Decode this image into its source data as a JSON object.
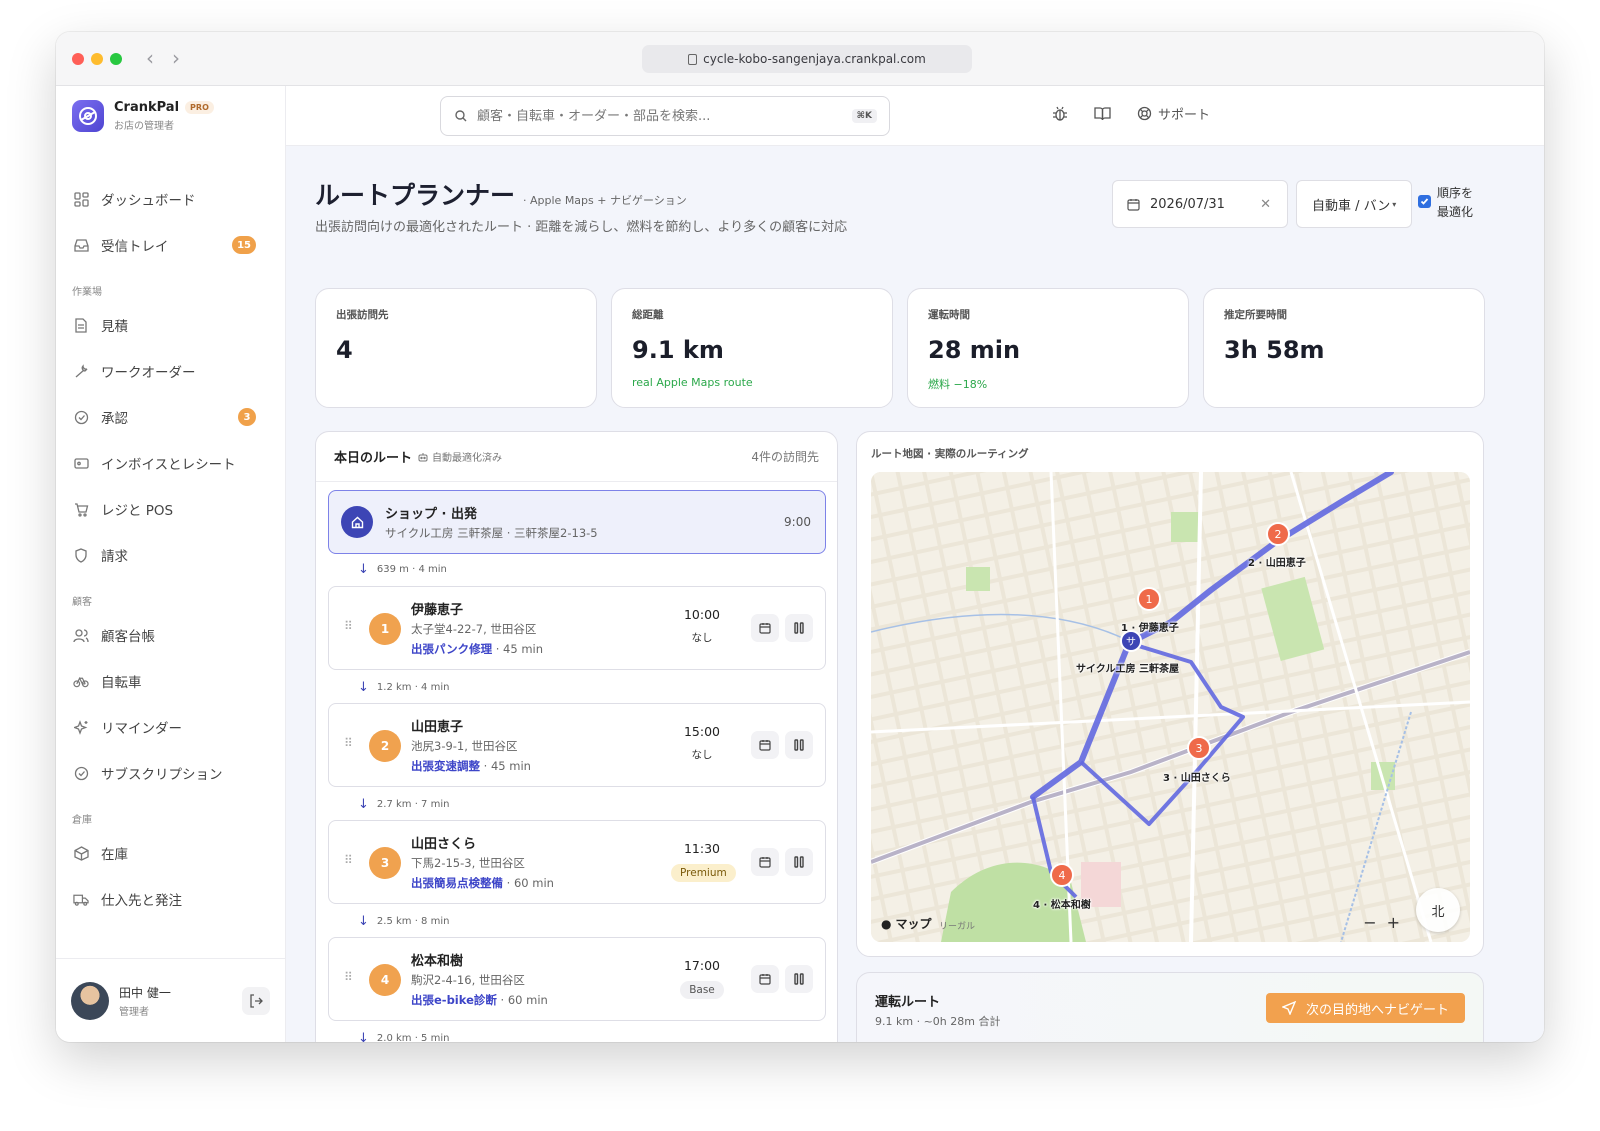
{
  "browser": {
    "url": "cycle-kobo-sangenjaya.crankpal.com"
  },
  "brand": {
    "name": "CrankPal",
    "tier": "PRO",
    "subtitle": "お店の管理者"
  },
  "nav": {
    "dashboard": "ダッシュボード",
    "inbox": "受信トレイ",
    "inbox_badge": "15",
    "section_workshop": "作業場",
    "estimates": "見積",
    "work_orders": "ワークオーダー",
    "approvals": "承認",
    "approvals_badge": "3",
    "invoices": "インボイスとレシート",
    "pos": "レジと POS",
    "billing": "請求",
    "section_customers": "顧客",
    "customer_ledger": "顧客台帳",
    "bikes": "自転車",
    "reminders": "リマインダー",
    "subscriptions": "サブスクリプション",
    "section_warehouse": "倉庫",
    "inventory": "在庫",
    "suppliers": "仕入先と発注"
  },
  "user": {
    "name": "田中 健一",
    "role": "管理者"
  },
  "topbar": {
    "search_placeholder": "顧客・自転車・オーダー・部品を検索...",
    "shortcut": "⌘K",
    "support": "サポート"
  },
  "page": {
    "title": "ルートプランナー",
    "subtitle": "· Apple Maps + ナビゲーション",
    "description": "出張訪問向けの最適化されたルート · 距離を減らし、燃料を節約し、より多くの顧客に対応",
    "date": "2026/07/31",
    "vehicle": "自動車 / バン",
    "optimize_line1": "順序を",
    "optimize_line2": "最適化"
  },
  "stats": [
    {
      "label": "出張訪問先",
      "value": "4",
      "note": ""
    },
    {
      "label": "総距離",
      "value": "9.1 km",
      "note": "real Apple Maps route"
    },
    {
      "label": "運転時間",
      "value": "28 min",
      "note": "燃料 −18%"
    },
    {
      "label": "推定所要時間",
      "value": "3h 58m",
      "note": ""
    }
  ],
  "route": {
    "title": "本日のルート",
    "auto_label": "自動最適化済み",
    "count": "4件の訪問先",
    "shop": {
      "name": "ショップ · 出発",
      "address": "サイクル工房 三軒茶屋 · 三軒茶屋2-13-5",
      "time": "9:00"
    },
    "legs": [
      "639 m · 4 min",
      "1.2 km · 4 min",
      "2.7 km · 7 min",
      "2.5 km · 8 min",
      "2.0 km · 5 min"
    ],
    "stops": [
      {
        "num": "1",
        "name": "伊藤恵子",
        "address": "太子堂4-22-7, 世田谷区",
        "service": "出張パンク修理",
        "duration": " · 45 min",
        "time": "10:00",
        "tag": "なし"
      },
      {
        "num": "2",
        "name": "山田恵子",
        "address": "池尻3-9-1, 世田谷区",
        "service": "出張変速調整",
        "duration": " · 45 min",
        "time": "15:00",
        "tag": "なし"
      },
      {
        "num": "3",
        "name": "山田さくら",
        "address": "下馬2-15-3, 世田谷区",
        "service": "出張簡易点検整備",
        "duration": " · 60 min",
        "time": "11:30",
        "tag": "Premium"
      },
      {
        "num": "4",
        "name": "松本和樹",
        "address": "駒沢2-4-16, 世田谷区",
        "service": "出張e-bike診断",
        "duration": " · 60 min",
        "time": "17:00",
        "tag": "Base"
      }
    ]
  },
  "map": {
    "label": "ルート地図 · 実際のルーティング",
    "pins": [
      {
        "num": "1",
        "label": "1 · 伊藤恵子"
      },
      {
        "num": "2",
        "label": "2 · 山田恵子"
      },
      {
        "num": "3",
        "label": "3 · 山田さくら"
      },
      {
        "num": "4",
        "label": "4 · 松本和樹"
      }
    ],
    "shop_pin": "サ",
    "shop_label": "サイクル工房 三軒茶屋",
    "brand": "マップ",
    "legal": "リーガル",
    "zoom_out": "−",
    "zoom_in": "+",
    "compass": "北"
  },
  "drive": {
    "title": "運転ルート",
    "summary": "9.1 km · ~0h 28m 合計",
    "button": "次の目的地へナビゲート"
  },
  "colors": {
    "accent": "#3d45b5",
    "orange": "#f0a24f",
    "route": "#6268e0",
    "pin": "#ef6a4a",
    "green": "#2ba84a"
  }
}
